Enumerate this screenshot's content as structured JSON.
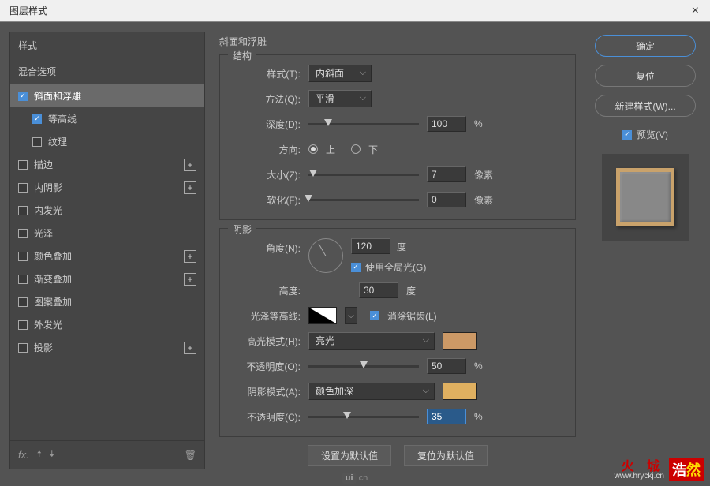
{
  "title": "图层样式",
  "left": {
    "stylesHeader": "样式",
    "blendOptions": "混合选项",
    "items": [
      {
        "label": "斜面和浮雕",
        "checked": true,
        "selected": true,
        "plus": false,
        "sub": false
      },
      {
        "label": "等高线",
        "checked": true,
        "selected": false,
        "plus": false,
        "sub": true
      },
      {
        "label": "纹理",
        "checked": false,
        "selected": false,
        "plus": false,
        "sub": true
      },
      {
        "label": "描边",
        "checked": false,
        "selected": false,
        "plus": true,
        "sub": false
      },
      {
        "label": "内阴影",
        "checked": false,
        "selected": false,
        "plus": true,
        "sub": false
      },
      {
        "label": "内发光",
        "checked": false,
        "selected": false,
        "plus": false,
        "sub": false
      },
      {
        "label": "光泽",
        "checked": false,
        "selected": false,
        "plus": false,
        "sub": false
      },
      {
        "label": "颜色叠加",
        "checked": false,
        "selected": false,
        "plus": true,
        "sub": false
      },
      {
        "label": "渐变叠加",
        "checked": false,
        "selected": false,
        "plus": true,
        "sub": false
      },
      {
        "label": "图案叠加",
        "checked": false,
        "selected": false,
        "plus": false,
        "sub": false
      },
      {
        "label": "外发光",
        "checked": false,
        "selected": false,
        "plus": false,
        "sub": false
      },
      {
        "label": "投影",
        "checked": false,
        "selected": false,
        "plus": true,
        "sub": false
      }
    ]
  },
  "mid": {
    "sectionTitle": "斜面和浮雕",
    "structure": {
      "legend": "结构",
      "styleLabel": "样式(T):",
      "styleValue": "内斜面",
      "techLabel": "方法(Q):",
      "techValue": "平滑",
      "depthLabel": "深度(D):",
      "depthValue": "100",
      "depthUnit": "%",
      "dirLabel": "方向:",
      "dirUp": "上",
      "dirDown": "下",
      "sizeLabel": "大小(Z):",
      "sizeValue": "7",
      "sizeUnit": "像素",
      "softenLabel": "软化(F):",
      "softenValue": "0",
      "softenUnit": "像素"
    },
    "shading": {
      "legend": "阴影",
      "angleLabel": "角度(N):",
      "angleValue": "120",
      "angleUnit": "度",
      "globalLight": "使用全局光(G)",
      "altitudeLabel": "高度:",
      "altitudeValue": "30",
      "altitudeUnit": "度",
      "contourLabel": "光泽等高线:",
      "antiAlias": "消除锯齿(L)",
      "hiModeLabel": "高光模式(H):",
      "hiModeValue": "亮光",
      "hiOpacityLabel": "不透明度(O):",
      "hiOpacityValue": "50",
      "hiOpacityUnit": "%",
      "shModeLabel": "阴影模式(A):",
      "shModeValue": "颜色加深",
      "shOpacityLabel": "不透明度(C):",
      "shOpacityValue": "35",
      "shOpacityUnit": "%"
    },
    "defaultBtn": "设置为默认值",
    "resetBtn": "复位为默认值"
  },
  "right": {
    "ok": "确定",
    "cancel": "复位",
    "newStyle": "新建样式(W)...",
    "preview": "预览(V)"
  },
  "watermark": {
    "badge1": "浩",
    "badge2": "然",
    "text1": "火 城",
    "url": "www.hryckj.cn"
  },
  "uiLogo": "cn"
}
